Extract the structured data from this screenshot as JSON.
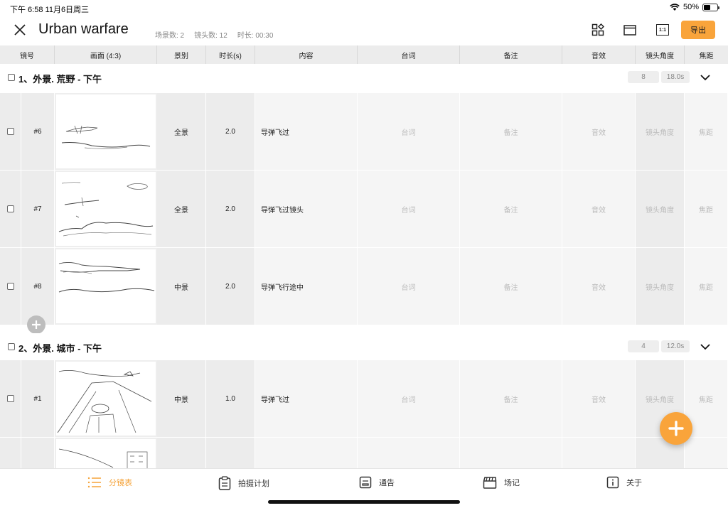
{
  "status": {
    "time": "下午 6:58   11月6日周三",
    "battery": "50%",
    "battery_level": 0.5
  },
  "header": {
    "title": "Urban warfare",
    "scene_count": "场景数: 2",
    "shot_count": "镜头数: 12",
    "duration": "时长: 00:30",
    "export_label": "导出",
    "ratio_label": "1:1",
    "accent_color": "#f9a43b"
  },
  "columns": [
    "镜号",
    "画面 (4:3)",
    "景别",
    "时长(s)",
    "内容",
    "台词",
    "备注",
    "音效",
    "镜头角度",
    "焦距"
  ],
  "placeholders": {
    "dialogue": "台词",
    "notes": "备注",
    "sound": "音效",
    "angle": "镜头角度",
    "focal": "焦距"
  },
  "scenes": [
    {
      "title": "1、外景. 荒野 - 下午",
      "count": "8",
      "duration": "18.0s",
      "shots": [
        {
          "no": "#6",
          "size": "全景",
          "duration": "2.0",
          "content": "导弹飞过"
        },
        {
          "no": "#7",
          "size": "全景",
          "duration": "2.0",
          "content": "导弹飞过镜头"
        },
        {
          "no": "#8",
          "size": "中景",
          "duration": "2.0",
          "content": "导弹飞行途中"
        }
      ]
    },
    {
      "title": "2、外景. 城市 - 下午",
      "count": "4",
      "duration": "12.0s",
      "shots": [
        {
          "no": "#1",
          "size": "中景",
          "duration": "1.0",
          "content": "导弹飞过"
        }
      ]
    }
  ],
  "tabs": [
    {
      "label": "分镜表",
      "icon": "list-icon",
      "active": true
    },
    {
      "label": "拍摄计划",
      "icon": "clipboard-icon",
      "active": false
    },
    {
      "label": "通告",
      "icon": "notice-icon",
      "active": false
    },
    {
      "label": "场记",
      "icon": "clapperboard-icon",
      "active": false
    },
    {
      "label": "关于",
      "icon": "info-icon",
      "active": false
    }
  ]
}
